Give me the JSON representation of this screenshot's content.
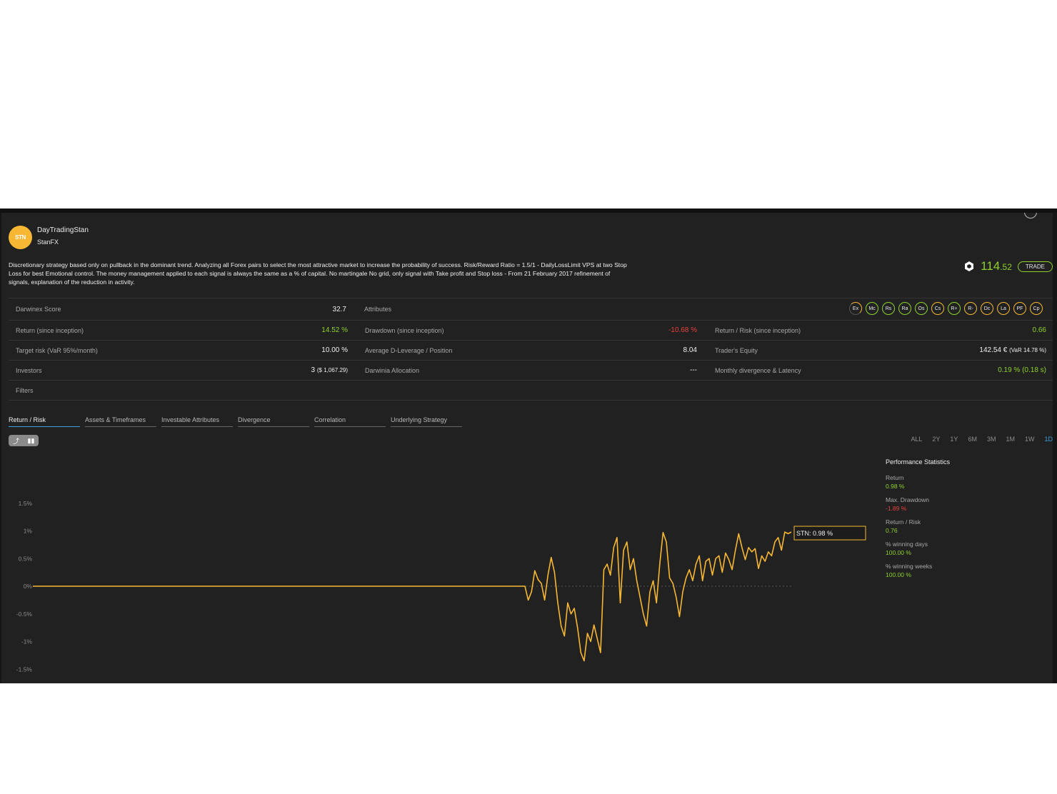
{
  "trader": {
    "avatar_text": "STN",
    "name": "DayTradingStan",
    "broker": "StanFX",
    "description": "Discretionary strategy based only on pullback in the dominant trend. Analyzing all Forex pairs to select the most attractive market to increase the probability of success. Risk/Reward Ratio = 1.5/1 - DailyLossLimit VPS at two Stop Loss for best Emotional control. The money management applied to each signal is always the same as a % of capital. No martingale No grid, only signal with Take profit and Stop loss - From 21 February 2017 refinement of signals, explanation of the reduction in activity."
  },
  "price": {
    "int": "114",
    "dec": ".52",
    "trade_label": "TRADE"
  },
  "stats": {
    "score_label": "Darwinex Score",
    "score_value": "32.7",
    "attributes_label": "Attributes",
    "attributes": [
      "Ex",
      "Mc",
      "Rs",
      "Ra",
      "Os",
      "Cs",
      "R+",
      "R-",
      "Dc",
      "La",
      "PF",
      "Cp"
    ],
    "return_label": "Return (since inception)",
    "return_value": "14.52 %",
    "drawdown_label": "Drawdown (since inception)",
    "drawdown_value": "-10.68 %",
    "return_risk_label": "Return / Risk (since inception)",
    "return_risk_value": "0.66",
    "target_risk_label": "Target risk (VaR 95%/month)",
    "target_risk_value": "10.00 %",
    "leverage_label": "Average D-Leverage / Position",
    "leverage_value": "8.04",
    "equity_label": "Trader's Equity",
    "equity_value": "142.54 €",
    "equity_sub": "(VaR 14.78 %)",
    "investors_label": "Investors",
    "investors_value": "3",
    "investors_sub": "($ 1,067.29)",
    "allocation_label": "Darwinia Allocation",
    "allocation_value": "---",
    "divergence_label": "Monthly divergence & Latency",
    "divergence_value": "0.19 % (0.18 s)",
    "filters_label": "Filters"
  },
  "tabs": [
    "Return / Risk",
    "Assets & Timeframes",
    "Investable Attributes",
    "Divergence",
    "Correlation",
    "Underlying Strategy"
  ],
  "ranges": [
    "ALL",
    "2Y",
    "1Y",
    "6M",
    "3M",
    "1M",
    "1W",
    "1D"
  ],
  "performance": {
    "title": "Performance Statistics",
    "items": [
      {
        "label": "Return",
        "value": "0.98 %",
        "tone": "green"
      },
      {
        "label": "Max. Drawdown",
        "value": "-1.89 %",
        "tone": "red"
      },
      {
        "label": "Return / Risk",
        "value": "0.76",
        "tone": "green"
      },
      {
        "label": "% winning days",
        "value": "100.00 %",
        "tone": "green"
      },
      {
        "label": "% winning weeks",
        "value": "100.00 %",
        "tone": "green"
      }
    ]
  },
  "colors": {
    "accent": "#f7b733",
    "positive": "#8fd12b",
    "negative": "#e8403e",
    "link": "#3aa0e0"
  },
  "chart_data": {
    "type": "line",
    "y_ticks": [
      "1.5%",
      "1%",
      "0.5%",
      "0%",
      "-0.5%",
      "-1%",
      "-1.5%"
    ],
    "ylim": [
      -1.5,
      1.5
    ],
    "series": [
      {
        "name": "STN",
        "tooltip": "STN: 0.98 %",
        "values": [
          0,
          0,
          0,
          0,
          0,
          0,
          0,
          0,
          0,
          0,
          0,
          0,
          0,
          0,
          0,
          0,
          0,
          0,
          0,
          0,
          0,
          0,
          0,
          0,
          0,
          0,
          0,
          0,
          0,
          0,
          0,
          0,
          0,
          0,
          0,
          0,
          0,
          0,
          0,
          0,
          0,
          0,
          0,
          0,
          0,
          0,
          0,
          0,
          0,
          0,
          0,
          0,
          0,
          0,
          0,
          0,
          0,
          0,
          0,
          0,
          -0.25,
          -0.1,
          0.28,
          0.12,
          0.05,
          -0.25,
          0.2,
          0.52,
          0.25,
          -0.3,
          -0.72,
          -0.9,
          -0.3,
          -0.5,
          -0.4,
          -0.75,
          -1.2,
          -1.35,
          -0.85,
          -1.0,
          -0.7,
          -0.95,
          -1.2,
          0.3,
          0.4,
          0.2,
          0.7,
          0.88,
          -0.3,
          0.65,
          0.8,
          0.3,
          0.5,
          0.1,
          -0.2,
          -0.5,
          -0.72,
          -0.1,
          0.1,
          -0.3,
          0.4,
          0.97,
          0.8,
          0.15,
          0.05,
          -0.2,
          -0.55,
          -0.1,
          0.15,
          0.3,
          0.1,
          0.4,
          0.55,
          0.1,
          0.45,
          0.5,
          0.2,
          0.5,
          0.55,
          0.25,
          0.6,
          0.48,
          0.3,
          0.65,
          0.95,
          0.7,
          0.48,
          0.7,
          0.62,
          0.68,
          0.32,
          0.55,
          0.45,
          0.62,
          0.55,
          0.8,
          0.88,
          0.65,
          0.98,
          0.95,
          0.98
        ]
      }
    ]
  }
}
